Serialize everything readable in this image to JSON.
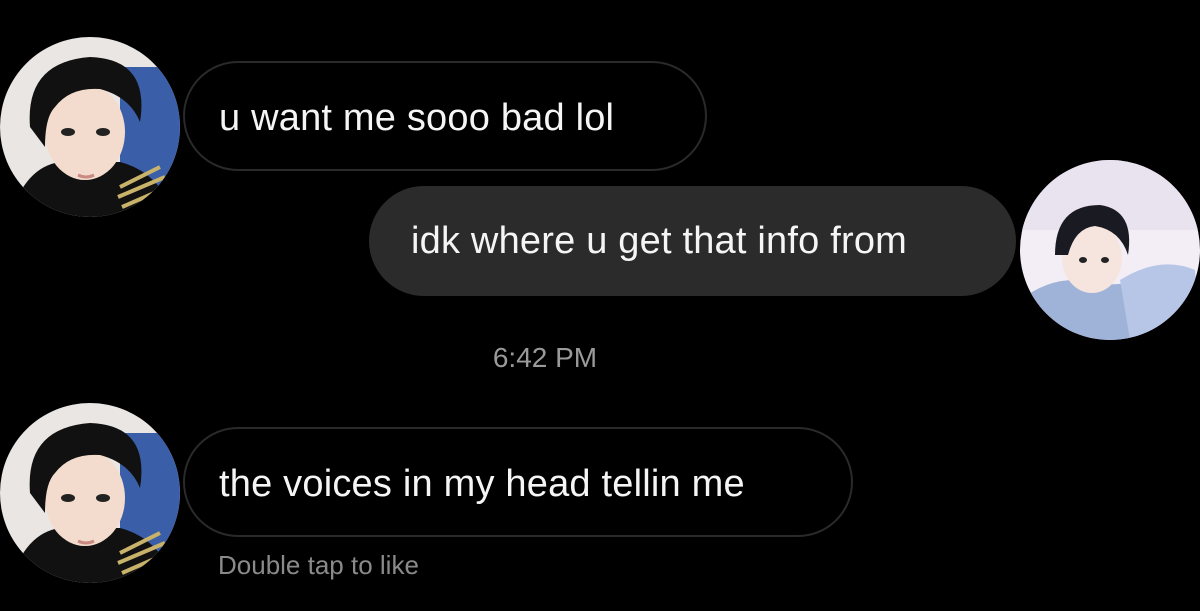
{
  "conversation": {
    "messages": [
      {
        "sender": "left",
        "text": "u want me sooo bad lol"
      },
      {
        "sender": "right",
        "text": "idk where u get that info from"
      },
      {
        "sender": "left",
        "text": "the voices in my head tellin me"
      }
    ],
    "timestamp": "6:42 PM",
    "double_tap_hint": "Double tap to like"
  },
  "colors": {
    "background": "#000000",
    "outgoing_bubble": "#2b2b2b",
    "incoming_bubble_border": "#2a2a2a",
    "meta_text": "#9a9a9a"
  }
}
